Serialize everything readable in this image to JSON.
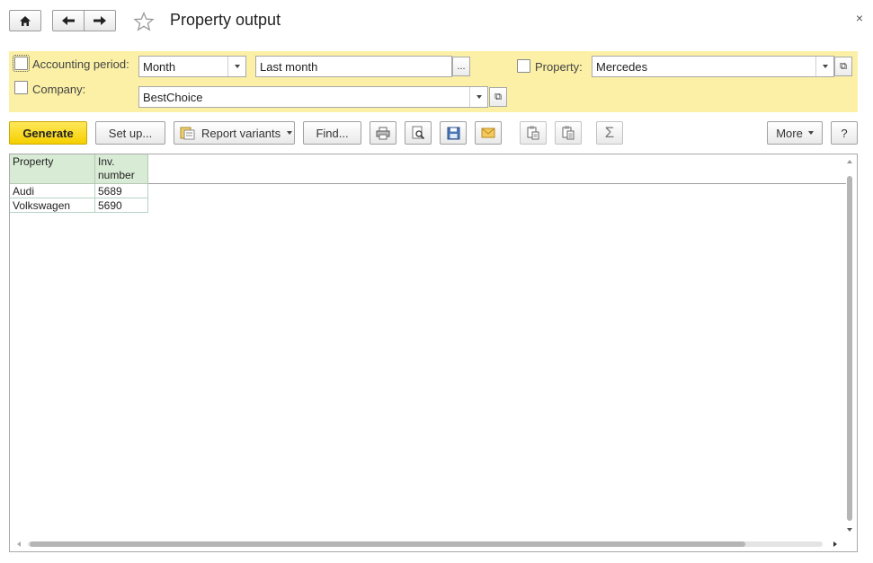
{
  "window": {
    "title": "Property output",
    "close_glyph": "×"
  },
  "nav": {
    "home_icon": "home-icon",
    "back_icon": "arrow-left-icon",
    "forward_icon": "arrow-right-icon",
    "favorite_icon": "star-icon"
  },
  "filters": {
    "accounting_period": {
      "label": "Accounting period:",
      "checked": false,
      "period_type": "Month",
      "period_value": "Last month",
      "ellipsis": "..."
    },
    "company": {
      "label": "Company:",
      "checked": false,
      "value": "BestChoice"
    },
    "property": {
      "label": "Property:",
      "checked": false,
      "value": "Mercedes"
    },
    "open_glyph": "⧉"
  },
  "toolbar": {
    "generate": "Generate",
    "setup": "Set up...",
    "report_variants": "Report variants",
    "find": "Find...",
    "print_icon": "printer-icon",
    "preview_icon": "print-preview-icon",
    "save_icon": "save-icon",
    "mail_icon": "mail-icon",
    "copy_icon": "copy-icon",
    "paste_icon": "paste-icon",
    "sum_glyph": "Σ",
    "more": "More",
    "help": "?"
  },
  "report": {
    "columns": [
      "Property",
      "Inv.\nnumber"
    ],
    "rows": [
      [
        "Audi",
        "5689"
      ],
      [
        "Volkswagen",
        "5690"
      ]
    ]
  },
  "colors": {
    "filter_bg": "#fbf0a5",
    "primary_button": "#f5cf00",
    "header_cell": "#d8ebd5"
  }
}
